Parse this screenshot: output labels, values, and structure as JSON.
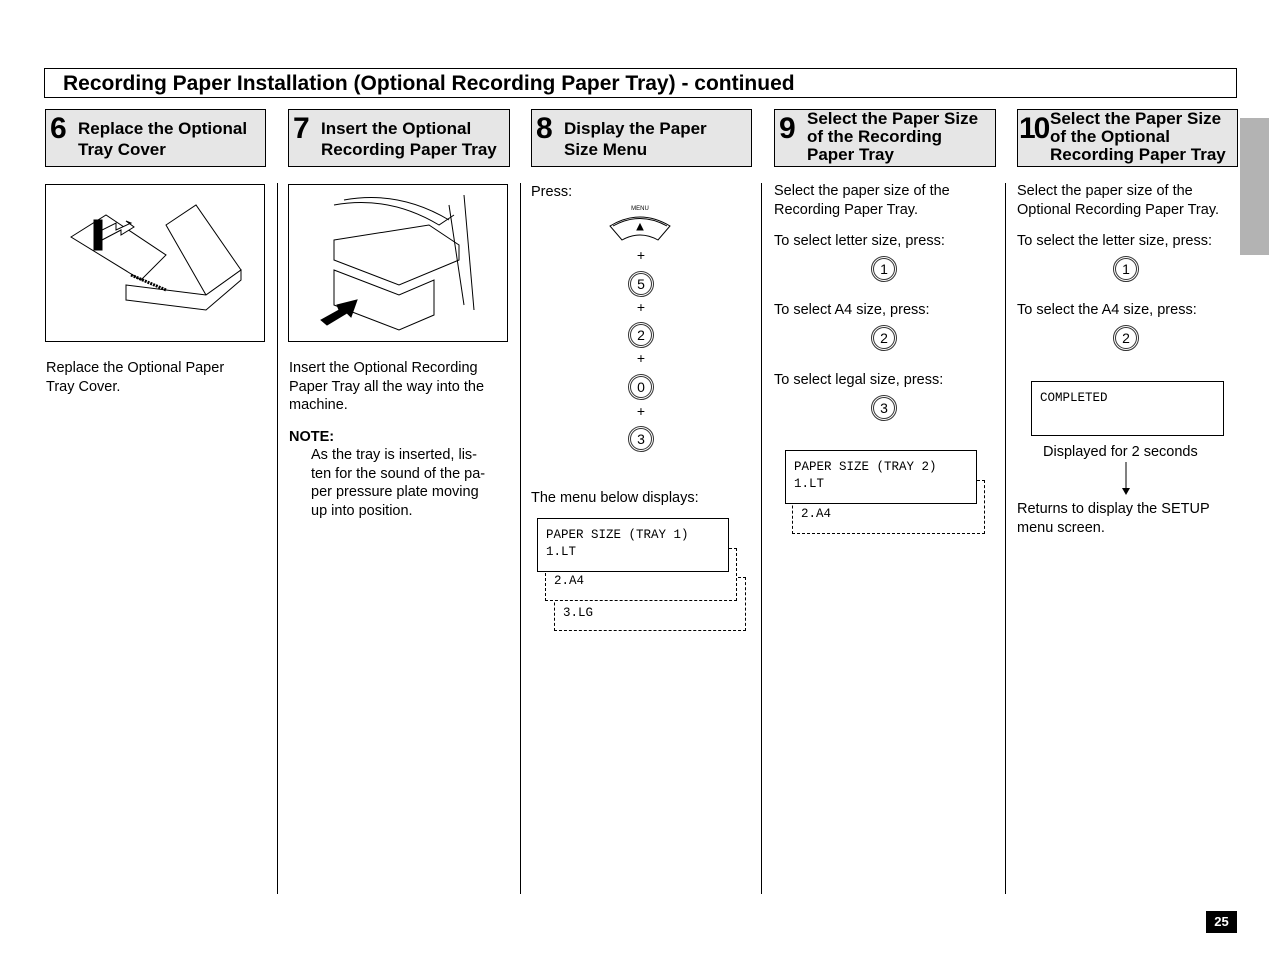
{
  "title": "Recording Paper Installation (Optional Recording Paper Tray) - continued",
  "page_number": "25",
  "colors": {
    "header_bg": "#e6e6e6",
    "side_tab": "#b3b3b3"
  },
  "steps": [
    {
      "num": "6",
      "title": [
        "Replace the Optional",
        "Tray Cover"
      ],
      "body": [
        "Replace the Optional Paper",
        "Tray Cover."
      ]
    },
    {
      "num": "7",
      "title": [
        "Insert the Optional",
        "Recording Paper Tray"
      ],
      "body": [
        "Insert the Optional Recording",
        "Paper Tray all the way into the",
        "machine."
      ],
      "note_label": "NOTE:",
      "note": [
        "As the tray is inserted, lis-",
        "ten for the sound of the pa-",
        "per pressure plate moving",
        "up into position."
      ]
    },
    {
      "num": "8",
      "title": [
        "Display the Paper",
        "Size Menu"
      ],
      "press": "Press:",
      "menu_key": "MENU",
      "keys": [
        "5",
        "2",
        "0",
        "3"
      ],
      "plus": "+",
      "after": "The menu below displays:",
      "lcd": [
        "PAPER SIZE (TRAY 1)",
        "1.LT"
      ],
      "options": [
        "2.A4",
        "3.LG"
      ]
    },
    {
      "num": "9",
      "title": [
        "Select the Paper Size",
        "of the Recording",
        "Paper Tray"
      ],
      "intro": [
        "Select the paper size of the",
        "Recording Paper Tray."
      ],
      "choices": [
        {
          "text": "To select letter size, press:",
          "key": "1"
        },
        {
          "text": "To select A4 size, press:",
          "key": "2"
        },
        {
          "text": "To select legal size, press:",
          "key": "3"
        }
      ],
      "lcd": [
        "PAPER SIZE (TRAY 2)",
        "1.LT"
      ],
      "options": [
        "2.A4"
      ]
    },
    {
      "num": "10",
      "title": [
        "Select the Paper Size",
        "of the Optional",
        "Recording Paper Tray"
      ],
      "intro": [
        "Select the paper size of the",
        "Optional Recording Paper Tray."
      ],
      "choices": [
        {
          "text": "To select the letter size, press:",
          "key": "1"
        },
        {
          "text": "To select the A4 size, press:",
          "key": "2"
        }
      ],
      "lcd": "COMPLETED",
      "displayed": "Displayed for 2 seconds",
      "returns": [
        "Returns to display the SETUP",
        "menu screen."
      ]
    }
  ]
}
